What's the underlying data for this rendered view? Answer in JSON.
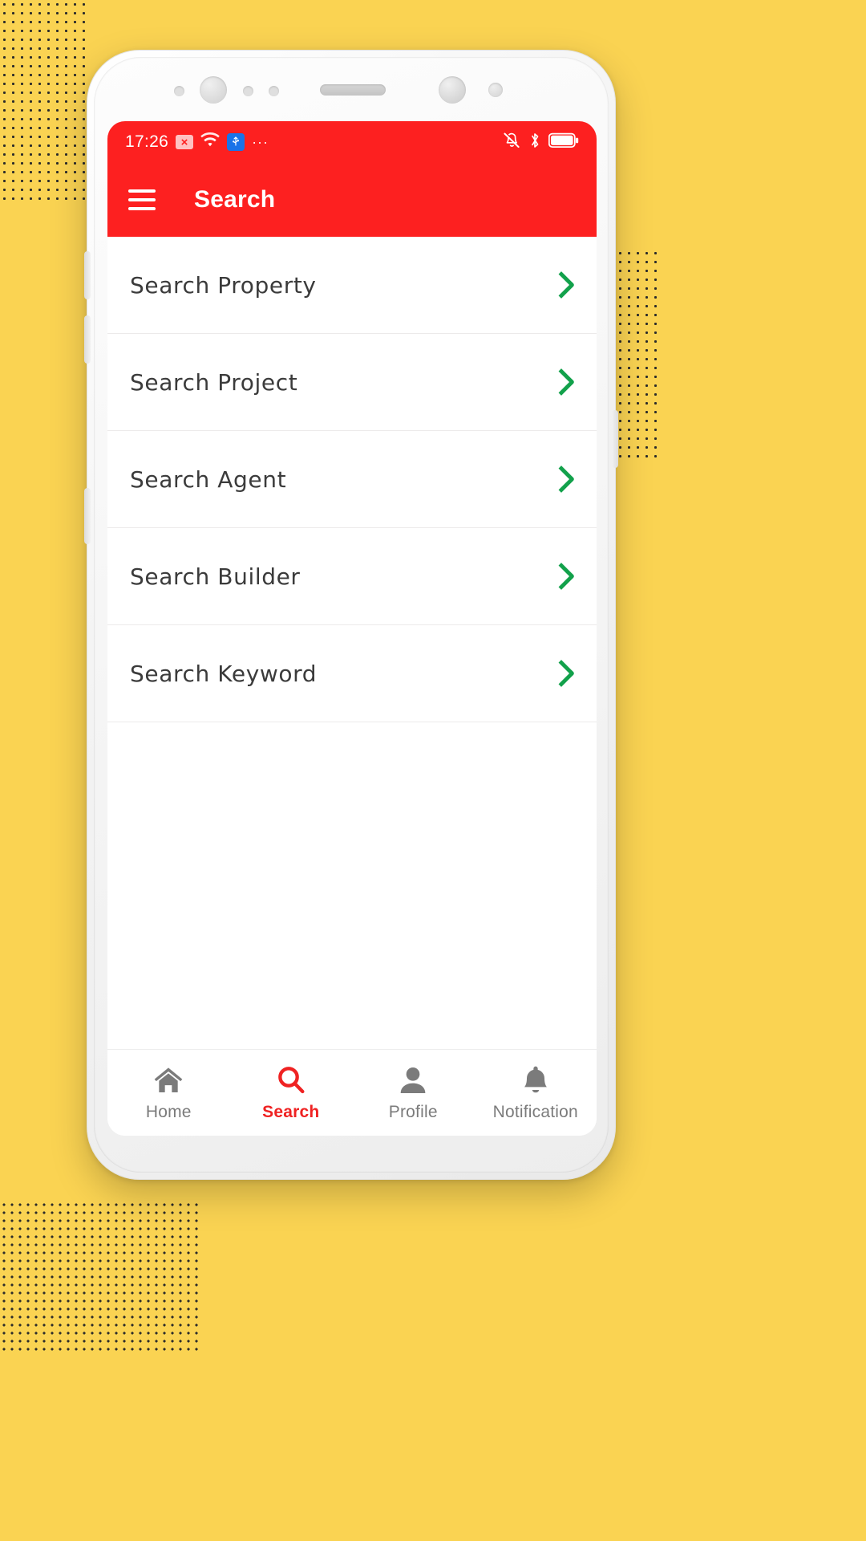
{
  "theme": {
    "background": "#fad352",
    "header_red": "#fd2020",
    "chevron_green": "#12a14b",
    "active_nav": "#ef2222",
    "inactive_nav": "#7b7b7b"
  },
  "status_bar": {
    "time": "17:26",
    "left_icons": [
      "sim-error-icon",
      "wifi-icon",
      "usb-icon",
      "more-icon"
    ],
    "more_glyph": "···",
    "right_icons": [
      "mute-bell-icon",
      "bluetooth-icon",
      "battery-icon"
    ],
    "bluetooth_glyph": "ᛦ"
  },
  "app_bar": {
    "menu_icon": "hamburger-menu-icon",
    "title": "Search"
  },
  "search_list": {
    "items": [
      {
        "label": "Search Property",
        "chevron": "chevron-right-icon"
      },
      {
        "label": "Search Project",
        "chevron": "chevron-right-icon"
      },
      {
        "label": "Search Agent",
        "chevron": "chevron-right-icon"
      },
      {
        "label": "Search Builder",
        "chevron": "chevron-right-icon"
      },
      {
        "label": "Search Keyword",
        "chevron": "chevron-right-icon"
      }
    ]
  },
  "bottom_nav": {
    "items": [
      {
        "label": "Home",
        "icon": "home-icon",
        "active": false
      },
      {
        "label": "Search",
        "icon": "search-icon",
        "active": true
      },
      {
        "label": "Profile",
        "icon": "person-icon",
        "active": false
      },
      {
        "label": "Notification",
        "icon": "bell-icon",
        "active": false
      }
    ]
  }
}
